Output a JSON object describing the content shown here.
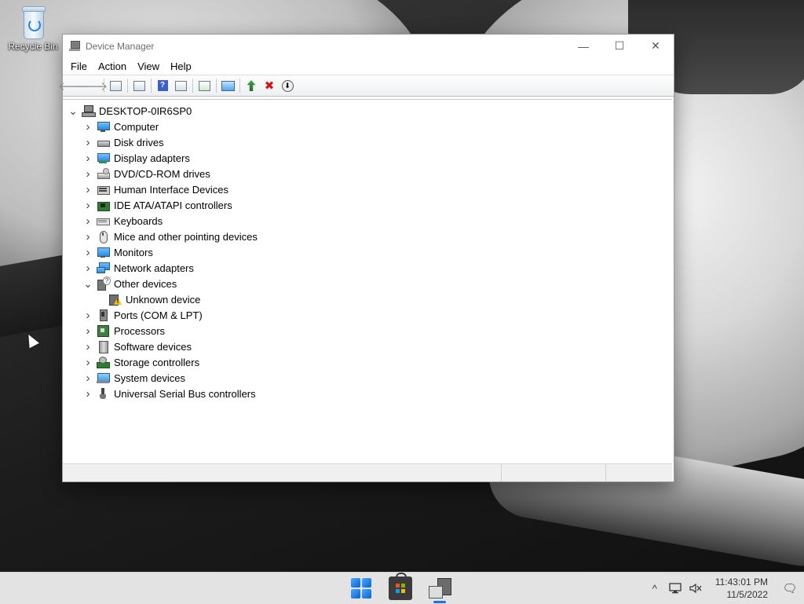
{
  "desktop": {
    "icons": [
      {
        "label": "Recycle Bin",
        "icon": "recycle-bin-icon"
      }
    ]
  },
  "window": {
    "title": "Device Manager",
    "controls": {
      "minimize": "—",
      "maximize": "☐",
      "close": "✕"
    },
    "menu": [
      "File",
      "Action",
      "View",
      "Help"
    ],
    "toolbar": [
      {
        "name": "back-icon",
        "glyph": "🡐",
        "color": "#8a8a8a"
      },
      {
        "name": "forward-icon",
        "glyph": "🡒",
        "color": "#8a8a8a"
      },
      {
        "name": "show-hide-console-tree-icon"
      },
      {
        "name": "properties-icon"
      },
      {
        "name": "help-icon",
        "glyph": "?"
      },
      {
        "name": "show-action-pane-icon"
      },
      {
        "name": "update-driver-icon"
      },
      {
        "name": "scan-hardware-changes-icon"
      },
      {
        "name": "enable-device-icon"
      },
      {
        "name": "uninstall-device-icon",
        "glyph": "✖",
        "color": "#d41414"
      },
      {
        "name": "download-driver-icon",
        "glyph": "⬇"
      }
    ],
    "tree": {
      "root": "DESKTOP-0IR6SP0",
      "categories": [
        {
          "label": "Computer",
          "icon": "computer",
          "expanded": false
        },
        {
          "label": "Disk drives",
          "icon": "disk",
          "expanded": false
        },
        {
          "label": "Display adapters",
          "icon": "display",
          "expanded": false
        },
        {
          "label": "DVD/CD-ROM drives",
          "icon": "dvd",
          "expanded": false
        },
        {
          "label": "Human Interface Devices",
          "icon": "hid",
          "expanded": false
        },
        {
          "label": "IDE ATA/ATAPI controllers",
          "icon": "ide",
          "expanded": false
        },
        {
          "label": "Keyboards",
          "icon": "keyboard",
          "expanded": false
        },
        {
          "label": "Mice and other pointing devices",
          "icon": "mouse",
          "expanded": false
        },
        {
          "label": "Monitors",
          "icon": "monitor",
          "expanded": false
        },
        {
          "label": "Network adapters",
          "icon": "network",
          "expanded": false
        },
        {
          "label": "Other devices",
          "icon": "other",
          "expanded": true,
          "children": [
            {
              "label": "Unknown device",
              "icon": "unknown"
            }
          ]
        },
        {
          "label": "Ports (COM & LPT)",
          "icon": "ports",
          "expanded": false
        },
        {
          "label": "Processors",
          "icon": "processor",
          "expanded": false
        },
        {
          "label": "Software devices",
          "icon": "software",
          "expanded": false
        },
        {
          "label": "Storage controllers",
          "icon": "storage",
          "expanded": false
        },
        {
          "label": "System devices",
          "icon": "system",
          "expanded": false
        },
        {
          "label": "Universal Serial Bus controllers",
          "icon": "usb",
          "expanded": false
        }
      ]
    },
    "status_panes": [
      "",
      "",
      ""
    ]
  },
  "taskbar": {
    "apps": [
      {
        "name": "start-button",
        "icon": "windows-start-icon",
        "active": false
      },
      {
        "name": "microsoft-store-button",
        "icon": "store-icon",
        "active": false
      },
      {
        "name": "device-manager-taskbar-button",
        "icon": "device-manager-icon",
        "active": true
      }
    ],
    "tray": {
      "chevron": "^",
      "icons": [
        "network-icon",
        "volume-muted-icon"
      ],
      "time": "11:43:01 PM",
      "date": "11/5/2022",
      "notification_glyph": "🗨"
    }
  },
  "colors": {
    "accent": "#1a73e8",
    "uninstall_red": "#d41414",
    "taskbar_bg": "#e3e3e3",
    "window_bg": "#ffffff"
  }
}
